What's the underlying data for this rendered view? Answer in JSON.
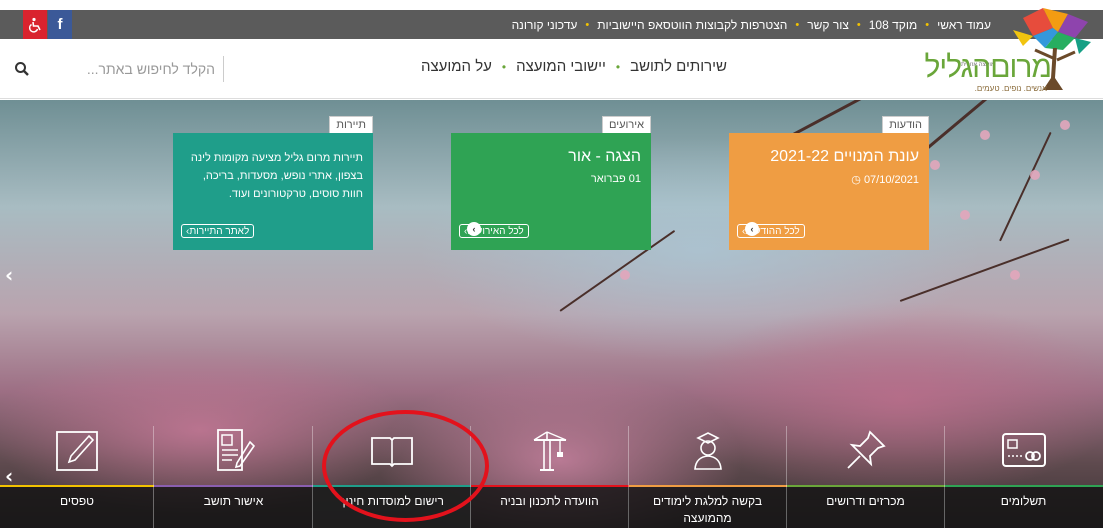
{
  "topbar": {
    "links": [
      "עמוד ראשי",
      "מוקד 108",
      "צור קשר",
      "הצטרפות לקבוצות הווטסאפ היישוביות",
      "עדכוני קורונה"
    ],
    "accessibility_icon": "wheelchair-icon",
    "facebook_label": "f"
  },
  "logo": {
    "name": "מרוםהגליל",
    "tagline": "אנשים. נופים. טעמים.",
    "top_label": "מועצה אזורית"
  },
  "search": {
    "placeholder": "הקלד לחיפוש באתר..."
  },
  "nav": {
    "items": [
      "שירותים לתושב",
      "יישובי המועצה",
      "על המועצה"
    ]
  },
  "cards": {
    "news": {
      "tag": "הודעות",
      "title": "עונת המנויים 2021-22",
      "date": "07/10/2021",
      "more": "לכל ההודעות",
      "color": "#ef9d43"
    },
    "events": {
      "tag": "אירועים",
      "title": "הצגה - אור",
      "date": "01 פברואר",
      "more": "לכל האירועים",
      "color": "#2fa354"
    },
    "tourism": {
      "tag": "תיירות",
      "body": "תיירות מרום גליל מציעה מקומות לינה בצפון, אתרי נופש, מסעדות, בריכה, חוות סוסים, טרקטורונים ועוד.",
      "more": "לאתר התיירות",
      "color": "#1f9e8a"
    }
  },
  "services": [
    {
      "label": "תשלומים",
      "icon": "credit-card-icon",
      "accent": "#2fa354"
    },
    {
      "label": "מכרזים ודרושים",
      "icon": "pushpin-icon",
      "accent": "#6aa63a"
    },
    {
      "label": "בקשה למלגת לימודים מהמועצה",
      "icon": "graduate-icon",
      "accent": "#ef9d43"
    },
    {
      "label": "הוועדה לתכנון ובניה",
      "icon": "crane-icon",
      "accent": "#e3121c"
    },
    {
      "label": "רישום למוסדות חינוך",
      "icon": "open-book-icon",
      "accent": "#1f9e8a"
    },
    {
      "label": "אישור תושב",
      "icon": "document-sign-icon",
      "accent": "#8a5fb0"
    },
    {
      "label": "טפסים",
      "icon": "pencil-icon",
      "accent": "#f2c200"
    }
  ]
}
